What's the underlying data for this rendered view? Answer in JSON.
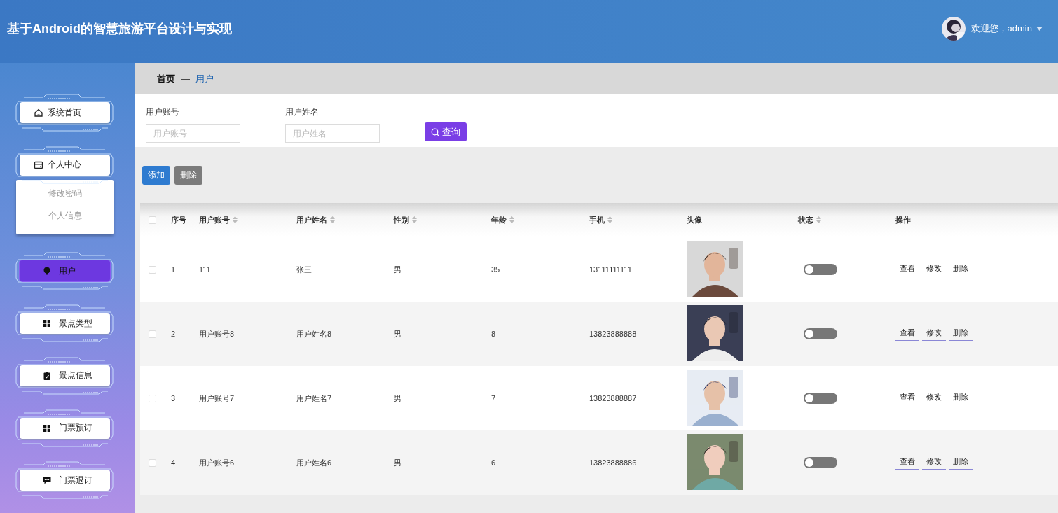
{
  "header": {
    "title": "基于Android的智慧旅游平台设计与实现",
    "greeting": "欢迎您，admin"
  },
  "sidebar": {
    "items": [
      {
        "label": "系统首页",
        "kind": "home",
        "selected": false
      },
      {
        "label": "个人中心",
        "kind": "card",
        "selected": false,
        "expanded": true,
        "children": [
          {
            "label": "修改密码"
          },
          {
            "label": "个人信息"
          }
        ]
      },
      {
        "label": "用户",
        "kind": "bulb",
        "selected": true
      },
      {
        "label": "景点类型",
        "kind": "grid",
        "selected": false
      },
      {
        "label": "景点信息",
        "kind": "clipboard",
        "selected": false
      },
      {
        "label": "门票预订",
        "kind": "grid",
        "selected": false
      },
      {
        "label": "门票退订",
        "kind": "chat",
        "selected": false
      }
    ]
  },
  "breadcrumb": {
    "separator": "—",
    "items": [
      {
        "label": "首页",
        "selected": false
      },
      {
        "label": "用户",
        "selected": true
      }
    ]
  },
  "search": {
    "fields": [
      {
        "label": "用户账号",
        "placeholder": "用户账号"
      },
      {
        "label": "用户姓名",
        "placeholder": "用户姓名"
      }
    ],
    "button": "查询"
  },
  "actions": [
    {
      "label": "添加",
      "kind": "primary"
    },
    {
      "label": "删除",
      "kind": "secondary"
    }
  ],
  "table": {
    "select_all": {
      "checked": false
    },
    "columns": [
      {
        "label": "序号",
        "sortable": false
      },
      {
        "label": "用户账号",
        "sortable": true
      },
      {
        "label": "用户姓名",
        "sortable": true
      },
      {
        "label": "性别",
        "sortable": true
      },
      {
        "label": "年龄",
        "sortable": true
      },
      {
        "label": "手机",
        "sortable": true
      },
      {
        "label": "头像",
        "sortable": false
      },
      {
        "label": "状态",
        "sortable": true
      },
      {
        "label": "操作",
        "sortable": false
      }
    ],
    "rows": [
      {
        "checked": false,
        "cells": [
          "1",
          "111",
          "张三",
          "男",
          "35",
          "13111111111"
        ],
        "on": false,
        "actions": [
          "查看",
          "修改",
          "删除"
        ]
      },
      {
        "checked": false,
        "cells": [
          "2",
          "用户账号8",
          "用户姓名8",
          "男",
          "8",
          "13823888888"
        ],
        "on": false,
        "actions": [
          "查看",
          "修改",
          "删除"
        ]
      },
      {
        "checked": false,
        "cells": [
          "3",
          "用户账号7",
          "用户姓名7",
          "男",
          "7",
          "13823888887"
        ],
        "on": false,
        "actions": [
          "查看",
          "修改",
          "删除"
        ]
      },
      {
        "checked": false,
        "cells": [
          "4",
          "用户账号6",
          "用户姓名6",
          "男",
          "6",
          "13823888886"
        ],
        "on": false,
        "actions": [
          "查看",
          "修改",
          "删除"
        ]
      }
    ]
  }
}
